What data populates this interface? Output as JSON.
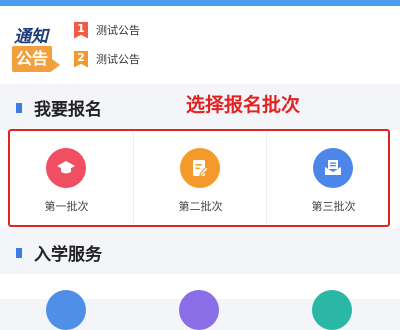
{
  "notice": {
    "logo_top": "通知",
    "logo_bottom": "公告",
    "items": [
      {
        "index": "1",
        "text": "测试公告"
      },
      {
        "index": "2",
        "text": "测试公告"
      }
    ]
  },
  "register": {
    "title": "我要报名",
    "annotation": "选择报名批次",
    "batches": [
      {
        "label": "第一批次",
        "icon": "graduation-cap-icon",
        "color": "#ef4e63"
      },
      {
        "label": "第二批次",
        "icon": "edit-form-icon",
        "color": "#f49a2a"
      },
      {
        "label": "第三批次",
        "icon": "mail-icon",
        "color": "#4d86ea"
      }
    ]
  },
  "services": {
    "title": "入学服务",
    "icons": [
      {
        "icon": "service-icon-1",
        "color": "#4f8fe8"
      },
      {
        "icon": "service-icon-2",
        "color": "#8a6ee8"
      },
      {
        "icon": "service-icon-3",
        "color": "#2bb7a6"
      }
    ]
  },
  "colors": {
    "accent": "#3a7fe0",
    "annotation": "#e52222",
    "logo_orange": "#f2a03d"
  }
}
